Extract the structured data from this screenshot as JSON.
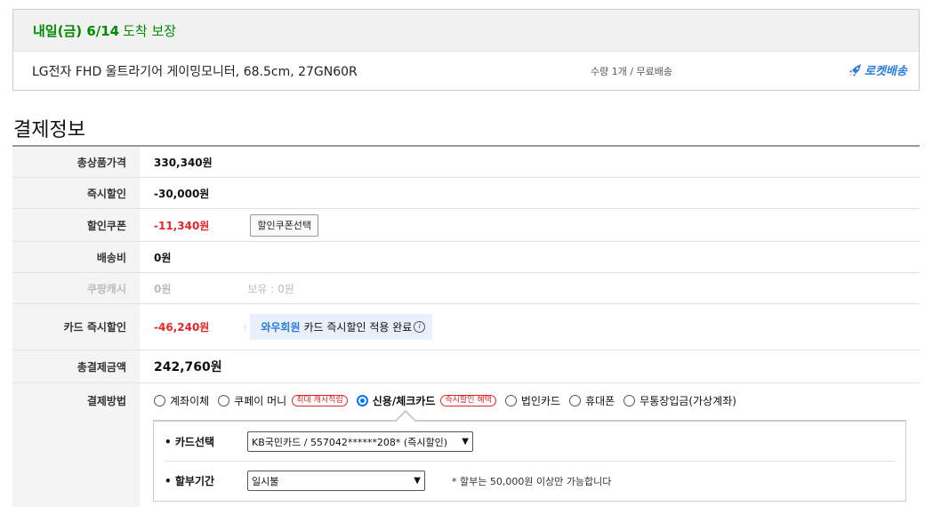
{
  "delivery": {
    "arrival_date": "내일(금) 6/14",
    "arrival_guarantee": "도착 보장",
    "product_name": "LG전자 FHD 울트라기어 게이밍모니터, 68.5cm, 27GN60R",
    "qty_info": "수량 1개 / 무료배송",
    "rocket_label": "로켓배송"
  },
  "section_title": "결제정보",
  "payment": {
    "rows": {
      "product_total": {
        "label": "총상품가격",
        "value": "330,340원"
      },
      "instant_discount": {
        "label": "즉시할인",
        "value": "-30,000원"
      },
      "coupon": {
        "label": "할인쿠폰",
        "value": "-11,340원",
        "button": "할인쿠폰선택"
      },
      "shipping": {
        "label": "배송비",
        "value": "0원"
      },
      "cash": {
        "label": "쿠팡캐시",
        "value": "0원",
        "reserve": "보유 : 0원"
      },
      "card_instant": {
        "label": "카드 즉시할인",
        "value": "-46,240원",
        "wow_name": "와우회원",
        "wow_text": "카드 즉시할인 적용 완료"
      },
      "grand_total": {
        "label": "총결제금액",
        "value": "242,760원"
      },
      "method": {
        "label": "결제방법"
      }
    },
    "methods": [
      {
        "label": "계좌이체",
        "selected": false
      },
      {
        "label": "쿠페이 머니",
        "selected": false,
        "badge": "최대 캐시적립"
      },
      {
        "label": "신용/체크카드",
        "selected": true,
        "badge": "즉시할인 혜택"
      },
      {
        "label": "법인카드",
        "selected": false
      },
      {
        "label": "휴대폰",
        "selected": false
      },
      {
        "label": "무통장입금(가상계좌)",
        "selected": false
      }
    ],
    "card_select": {
      "label": "카드선택",
      "value": "KB국민카드 / 557042******208* (즉시할인)"
    },
    "installment": {
      "label": "할부기간",
      "value": "일시불",
      "note": "* 할부는 50,000원 이상만 가능합니다"
    }
  },
  "colors": {
    "green": "#008c00",
    "red": "#e52528",
    "blue": "#2a7de1"
  }
}
